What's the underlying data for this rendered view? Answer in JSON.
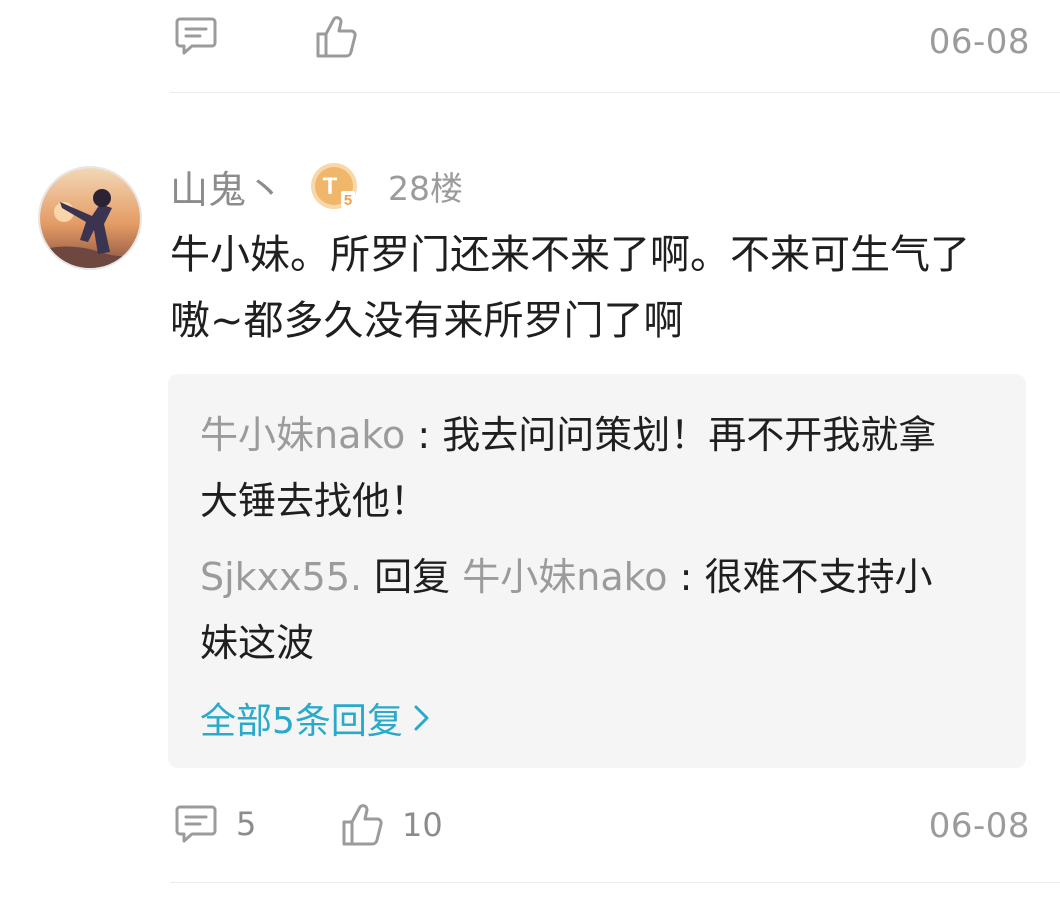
{
  "previous_comment": {
    "date": "06-08"
  },
  "comment": {
    "username": "山鬼丶",
    "level_badge": {
      "letter": "T",
      "number": "5"
    },
    "floor": "28楼",
    "text": "牛小妹。所罗门还来不来了啊。不来可生气了嗷~都多久没有来所罗门了啊",
    "text_line1": "牛小妹。所罗门还来不来了啊。不来可生气了",
    "text_line2": "嗷~都多久没有来所罗门了啊",
    "replies": [
      {
        "author": "牛小妹nako",
        "separator": " : ",
        "line1": "我去问问策划！再不开我就拿",
        "line2": "大锤去找他！"
      },
      {
        "author": "Sjkxx55.",
        "action": " 回复 ",
        "target": "牛小妹nako",
        "separator": " : ",
        "line1": "很难不支持小",
        "line2": "妹这波"
      }
    ],
    "more_replies_label": "全部5条回复",
    "reply_count": "5",
    "like_count": "10",
    "date": "06-08"
  },
  "icons": {
    "comment": "comment-icon",
    "like": "thumbs-up-icon",
    "chevron": "chevron-right-icon"
  },
  "colors": {
    "link": "#2aaacb",
    "muted": "#9b9b9b",
    "text": "#1f1f1f",
    "reply_bg": "#f5f5f5",
    "badge": "#f0b66a"
  }
}
